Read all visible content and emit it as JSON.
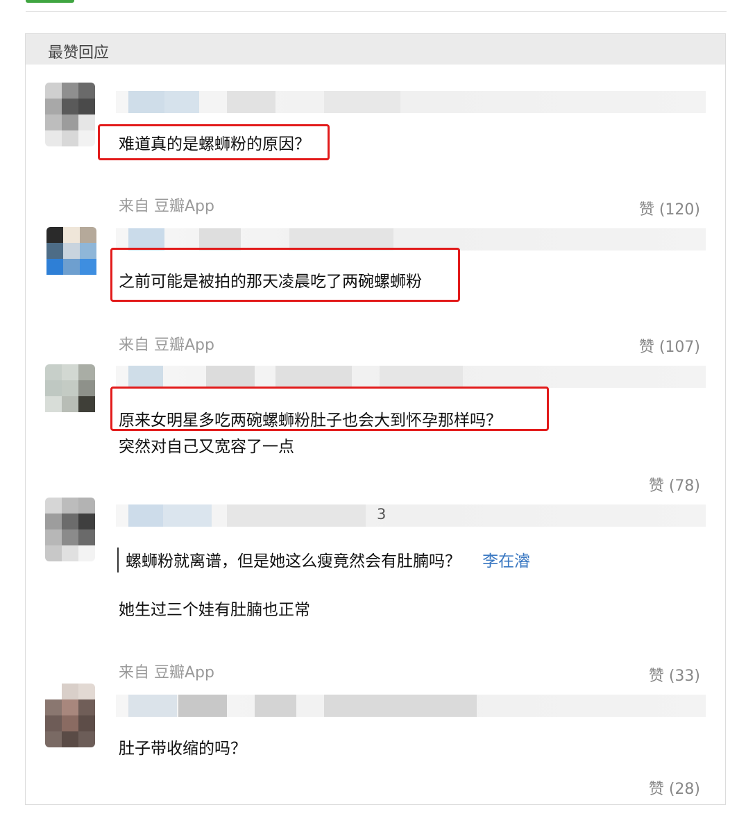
{
  "section_title": "最赞回应",
  "comments": [
    {
      "text": "难道真的是螺蛳粉的原因？",
      "source": "来自 豆瓣App",
      "likes": "赞 (120)"
    },
    {
      "text": "之前可能是被拍的那天凌晨吃了两碗螺蛳粉",
      "source": "来自 豆瓣App",
      "likes": "赞 (107)"
    },
    {
      "text": "原来女明星多吃两碗螺蛳粉肚子也会大到怀孕那样吗？",
      "text2": "突然对自己又宽容了一点",
      "likes": "赞 (78)"
    },
    {
      "name_suffix": "3",
      "quote": "螺蛳粉就离谱，但是她这么瘦竟然会有肚腩吗？",
      "quote_author": "李在濬",
      "text": "她生过三个娃有肚腩也正常",
      "source": "来自 豆瓣App",
      "likes": "赞 (33)"
    },
    {
      "text": "肚子带收缩的吗？",
      "likes": "赞 (28)"
    }
  ],
  "colors": {
    "highlight": "#e21b1b",
    "link": "#3a78c2",
    "accent_green": "#3fa540"
  }
}
